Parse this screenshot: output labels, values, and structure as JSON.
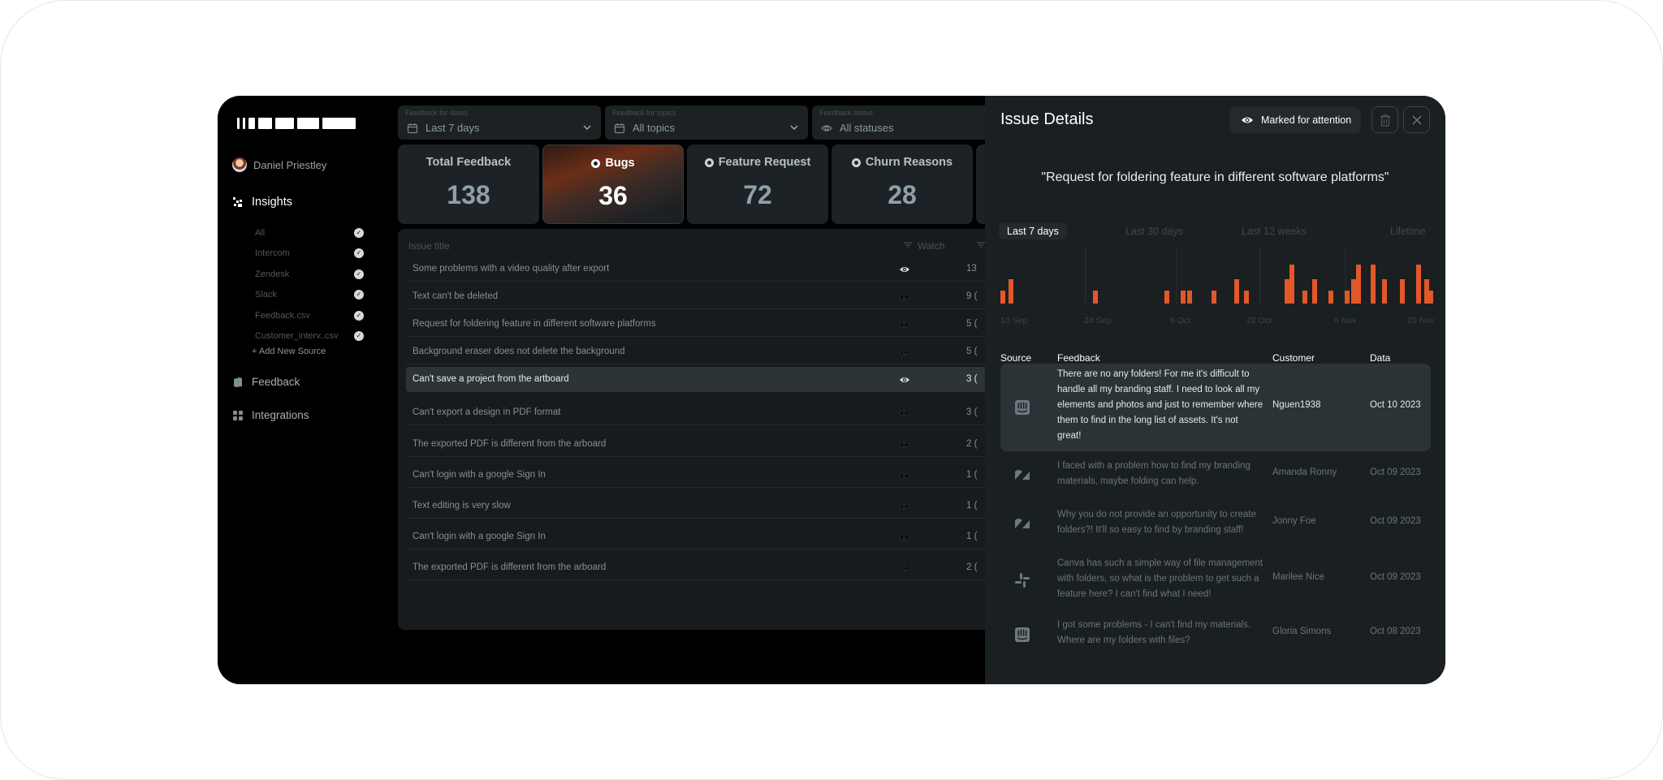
{
  "sidebar": {
    "user_name": "Daniel Priestley",
    "nav": {
      "insights": "Insights",
      "feedback": "Feedback",
      "integrations": "Integrations"
    },
    "sources": [
      {
        "label": "All"
      },
      {
        "label": "Intercom"
      },
      {
        "label": "Zendesk"
      },
      {
        "label": "Slack"
      },
      {
        "label": "Feedback.csv"
      },
      {
        "label": "Customer_interv..csv"
      }
    ],
    "add_source": "+ Add New Source"
  },
  "filters": {
    "dates": {
      "label": "Feedback for dates",
      "value": "Last 7 days",
      "icon": "calendar-icon"
    },
    "topics": {
      "label": "Feedback for topics",
      "value": "All topics",
      "icon": "calendar-icon"
    },
    "status": {
      "label": "Feedback status",
      "value": "All statuses",
      "icon": "eye-icon"
    }
  },
  "cards": [
    {
      "title": "Total Feedback",
      "value": "138"
    },
    {
      "title": "Bugs",
      "value": "36"
    },
    {
      "title": "Feature Request",
      "value": "72"
    },
    {
      "title": "Churn Reasons",
      "value": "28"
    }
  ],
  "issues": {
    "header": {
      "title": "Issue title",
      "watch": "Watch"
    },
    "rows": [
      {
        "title": "Some problems with a video quality after export",
        "count": "13",
        "watched": true
      },
      {
        "title": "Text can't be deleted",
        "count": "9 (",
        "watched": false
      },
      {
        "title": "Request for foldering feature in different software platforms",
        "count": "5 (",
        "watched": false
      },
      {
        "title": "Background eraser does not delete the background",
        "count": "5 (",
        "watched": false
      },
      {
        "title": "Can't save a project from the artboard",
        "count": "3 (",
        "watched": true
      },
      {
        "title": "Can't export a design in PDF format",
        "count": "3 (",
        "watched": false
      },
      {
        "title": "The exported PDF is different from the arboard",
        "count": "2 (",
        "watched": false
      },
      {
        "title": "Can't login with a google Sign In",
        "count": "1 (",
        "watched": false
      },
      {
        "title": "Text editing is very slow",
        "count": "1 (",
        "watched": false
      },
      {
        "title": "Can't login with a google Sign In",
        "count": "1 (",
        "watched": false
      },
      {
        "title": "The exported PDF is different from the arboard",
        "count": "2 (",
        "watched": false
      }
    ]
  },
  "details": {
    "title": "Issue Details",
    "mark_label": "Marked for attention",
    "quote": "\"Request for foldering feature in different software platforms\"",
    "ranges": [
      "Last 7 days",
      "Last 30 days",
      "Last 12 weeks",
      "Lifetime"
    ],
    "axis_labels": [
      "10 Sep",
      "24 Sep",
      "8 Oct",
      "22 Oct",
      "6 Nov",
      "20 Nov"
    ],
    "bar_color": "#e2582a",
    "table_header": {
      "source": "Source",
      "feedback": "Feedback",
      "customer": "Customer",
      "data": "Data"
    },
    "rows": [
      {
        "source_icon": "intercom-icon",
        "feedback": "There are no any folders! For me it's difficult to handle all my branding staff. I need to look all my elements and photos and just to remember where them to find in the long list of assets. It's not great!",
        "customer": "Nguen1938",
        "date": "Oct 10 2023"
      },
      {
        "source_icon": "zendesk-icon",
        "feedback": "I faced with a problem how to find my branding materials, maybe folding can help.",
        "customer": "Amanda Ronny",
        "date": "Oct 09 2023"
      },
      {
        "source_icon": "zendesk-icon",
        "feedback": "Why you do not provide an opportunity to create folders?! It'll so easy to find by branding staff!",
        "customer": "Jonny Foe",
        "date": "Oct 09 2023"
      },
      {
        "source_icon": "slack-icon",
        "feedback": "Canva has such a simple way of file management with folders, so what is the problem to get such a feature here? I can't find what I need!",
        "customer": "Marilee Nice",
        "date": "Oct 09 2023"
      },
      {
        "source_icon": "intercom-icon",
        "feedback": "I got some problems - I can't find my materials. Where are my folders with files?",
        "customer": "Gloria Simons",
        "date": "Oct 08 2023"
      }
    ]
  }
}
